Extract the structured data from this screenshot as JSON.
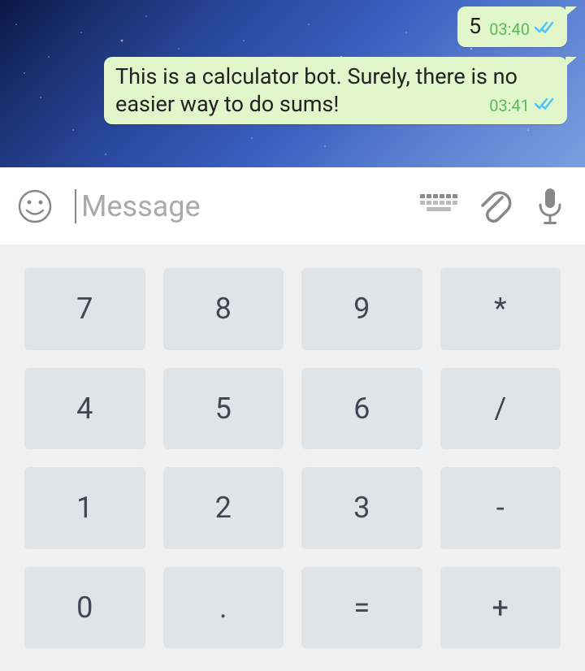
{
  "chat": {
    "messages": [
      {
        "text": "5",
        "time": "03:40"
      },
      {
        "text": "This is a calculator bot. Surely, there is no easier way to do sums!",
        "time": "03:41"
      }
    ]
  },
  "input": {
    "placeholder": "Message"
  },
  "keyboard": {
    "keys": [
      "7",
      "8",
      "9",
      "*",
      "4",
      "5",
      "6",
      "/",
      "1",
      "2",
      "3",
      "-",
      "0",
      ".",
      "=",
      "+"
    ]
  },
  "colors": {
    "bubble_bg": "#e1f7cb",
    "time": "#5cb85c",
    "tick": "#4fc3f7",
    "key_bg": "#dfe4e8",
    "keyboard_bg": "#f1f1f1"
  }
}
